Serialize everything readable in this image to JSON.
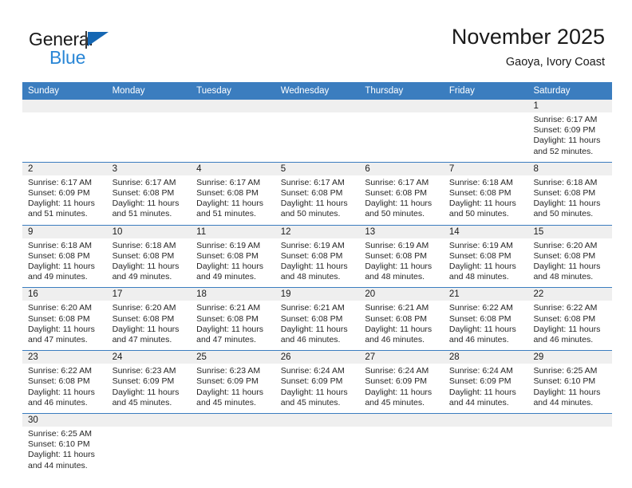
{
  "logo": {
    "word_primary": "General",
    "word_secondary": "Blue",
    "primary_color": "#1a1a1a",
    "secondary_color": "#2986d6",
    "flag_color": "#1567b3"
  },
  "header": {
    "title": "November 2025",
    "subtitle": "Gaoya, Ivory Coast"
  },
  "theme": {
    "header_blue": "#3b7dbf",
    "daynum_gray": "#efefef",
    "text_color": "#262626"
  },
  "weekdays": [
    "Sunday",
    "Monday",
    "Tuesday",
    "Wednesday",
    "Thursday",
    "Friday",
    "Saturday"
  ],
  "weeks": [
    [
      {
        "day": "",
        "lines": [
          "",
          "",
          "",
          ""
        ]
      },
      {
        "day": "",
        "lines": [
          "",
          "",
          "",
          ""
        ]
      },
      {
        "day": "",
        "lines": [
          "",
          "",
          "",
          ""
        ]
      },
      {
        "day": "",
        "lines": [
          "",
          "",
          "",
          ""
        ]
      },
      {
        "day": "",
        "lines": [
          "",
          "",
          "",
          ""
        ]
      },
      {
        "day": "",
        "lines": [
          "",
          "",
          "",
          ""
        ]
      },
      {
        "day": "1",
        "lines": [
          "Sunrise: 6:17 AM",
          "Sunset: 6:09 PM",
          "Daylight: 11 hours",
          "and 52 minutes."
        ]
      }
    ],
    [
      {
        "day": "2",
        "lines": [
          "Sunrise: 6:17 AM",
          "Sunset: 6:09 PM",
          "Daylight: 11 hours",
          "and 51 minutes."
        ]
      },
      {
        "day": "3",
        "lines": [
          "Sunrise: 6:17 AM",
          "Sunset: 6:08 PM",
          "Daylight: 11 hours",
          "and 51 minutes."
        ]
      },
      {
        "day": "4",
        "lines": [
          "Sunrise: 6:17 AM",
          "Sunset: 6:08 PM",
          "Daylight: 11 hours",
          "and 51 minutes."
        ]
      },
      {
        "day": "5",
        "lines": [
          "Sunrise: 6:17 AM",
          "Sunset: 6:08 PM",
          "Daylight: 11 hours",
          "and 50 minutes."
        ]
      },
      {
        "day": "6",
        "lines": [
          "Sunrise: 6:17 AM",
          "Sunset: 6:08 PM",
          "Daylight: 11 hours",
          "and 50 minutes."
        ]
      },
      {
        "day": "7",
        "lines": [
          "Sunrise: 6:18 AM",
          "Sunset: 6:08 PM",
          "Daylight: 11 hours",
          "and 50 minutes."
        ]
      },
      {
        "day": "8",
        "lines": [
          "Sunrise: 6:18 AM",
          "Sunset: 6:08 PM",
          "Daylight: 11 hours",
          "and 50 minutes."
        ]
      }
    ],
    [
      {
        "day": "9",
        "lines": [
          "Sunrise: 6:18 AM",
          "Sunset: 6:08 PM",
          "Daylight: 11 hours",
          "and 49 minutes."
        ]
      },
      {
        "day": "10",
        "lines": [
          "Sunrise: 6:18 AM",
          "Sunset: 6:08 PM",
          "Daylight: 11 hours",
          "and 49 minutes."
        ]
      },
      {
        "day": "11",
        "lines": [
          "Sunrise: 6:19 AM",
          "Sunset: 6:08 PM",
          "Daylight: 11 hours",
          "and 49 minutes."
        ]
      },
      {
        "day": "12",
        "lines": [
          "Sunrise: 6:19 AM",
          "Sunset: 6:08 PM",
          "Daylight: 11 hours",
          "and 48 minutes."
        ]
      },
      {
        "day": "13",
        "lines": [
          "Sunrise: 6:19 AM",
          "Sunset: 6:08 PM",
          "Daylight: 11 hours",
          "and 48 minutes."
        ]
      },
      {
        "day": "14",
        "lines": [
          "Sunrise: 6:19 AM",
          "Sunset: 6:08 PM",
          "Daylight: 11 hours",
          "and 48 minutes."
        ]
      },
      {
        "day": "15",
        "lines": [
          "Sunrise: 6:20 AM",
          "Sunset: 6:08 PM",
          "Daylight: 11 hours",
          "and 48 minutes."
        ]
      }
    ],
    [
      {
        "day": "16",
        "lines": [
          "Sunrise: 6:20 AM",
          "Sunset: 6:08 PM",
          "Daylight: 11 hours",
          "and 47 minutes."
        ]
      },
      {
        "day": "17",
        "lines": [
          "Sunrise: 6:20 AM",
          "Sunset: 6:08 PM",
          "Daylight: 11 hours",
          "and 47 minutes."
        ]
      },
      {
        "day": "18",
        "lines": [
          "Sunrise: 6:21 AM",
          "Sunset: 6:08 PM",
          "Daylight: 11 hours",
          "and 47 minutes."
        ]
      },
      {
        "day": "19",
        "lines": [
          "Sunrise: 6:21 AM",
          "Sunset: 6:08 PM",
          "Daylight: 11 hours",
          "and 46 minutes."
        ]
      },
      {
        "day": "20",
        "lines": [
          "Sunrise: 6:21 AM",
          "Sunset: 6:08 PM",
          "Daylight: 11 hours",
          "and 46 minutes."
        ]
      },
      {
        "day": "21",
        "lines": [
          "Sunrise: 6:22 AM",
          "Sunset: 6:08 PM",
          "Daylight: 11 hours",
          "and 46 minutes."
        ]
      },
      {
        "day": "22",
        "lines": [
          "Sunrise: 6:22 AM",
          "Sunset: 6:08 PM",
          "Daylight: 11 hours",
          "and 46 minutes."
        ]
      }
    ],
    [
      {
        "day": "23",
        "lines": [
          "Sunrise: 6:22 AM",
          "Sunset: 6:08 PM",
          "Daylight: 11 hours",
          "and 46 minutes."
        ]
      },
      {
        "day": "24",
        "lines": [
          "Sunrise: 6:23 AM",
          "Sunset: 6:09 PM",
          "Daylight: 11 hours",
          "and 45 minutes."
        ]
      },
      {
        "day": "25",
        "lines": [
          "Sunrise: 6:23 AM",
          "Sunset: 6:09 PM",
          "Daylight: 11 hours",
          "and 45 minutes."
        ]
      },
      {
        "day": "26",
        "lines": [
          "Sunrise: 6:24 AM",
          "Sunset: 6:09 PM",
          "Daylight: 11 hours",
          "and 45 minutes."
        ]
      },
      {
        "day": "27",
        "lines": [
          "Sunrise: 6:24 AM",
          "Sunset: 6:09 PM",
          "Daylight: 11 hours",
          "and 45 minutes."
        ]
      },
      {
        "day": "28",
        "lines": [
          "Sunrise: 6:24 AM",
          "Sunset: 6:09 PM",
          "Daylight: 11 hours",
          "and 44 minutes."
        ]
      },
      {
        "day": "29",
        "lines": [
          "Sunrise: 6:25 AM",
          "Sunset: 6:10 PM",
          "Daylight: 11 hours",
          "and 44 minutes."
        ]
      }
    ],
    [
      {
        "day": "30",
        "lines": [
          "Sunrise: 6:25 AM",
          "Sunset: 6:10 PM",
          "Daylight: 11 hours",
          "and 44 minutes."
        ]
      },
      {
        "day": "",
        "lines": [
          "",
          "",
          "",
          ""
        ]
      },
      {
        "day": "",
        "lines": [
          "",
          "",
          "",
          ""
        ]
      },
      {
        "day": "",
        "lines": [
          "",
          "",
          "",
          ""
        ]
      },
      {
        "day": "",
        "lines": [
          "",
          "",
          "",
          ""
        ]
      },
      {
        "day": "",
        "lines": [
          "",
          "",
          "",
          ""
        ]
      },
      {
        "day": "",
        "lines": [
          "",
          "",
          "",
          ""
        ]
      }
    ]
  ]
}
